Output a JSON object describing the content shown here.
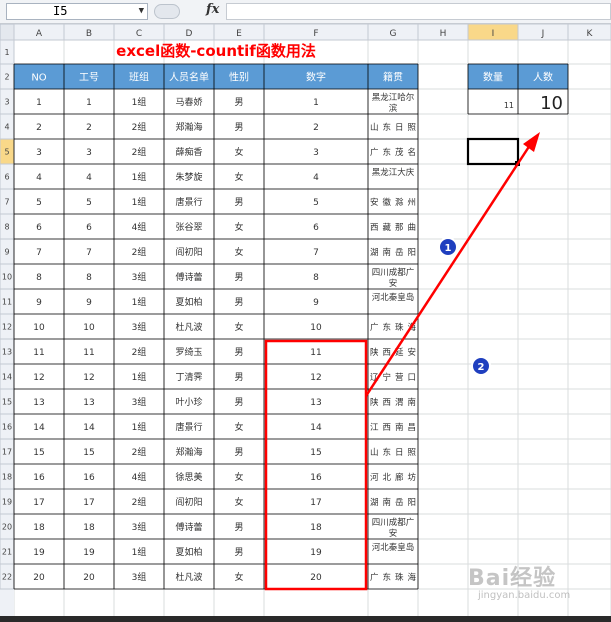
{
  "formula_bar": {
    "name_box": "I5",
    "fx_label": "fx",
    "formula": ""
  },
  "title": "excel函数-countif函数用法",
  "columns": [
    "A",
    "B",
    "C",
    "D",
    "E",
    "F",
    "G",
    "H",
    "I",
    "J",
    "K"
  ],
  "rows": [
    "1",
    "2",
    "3",
    "4",
    "5",
    "6",
    "7",
    "8",
    "9",
    "10",
    "11",
    "12",
    "13",
    "14",
    "15",
    "16",
    "17",
    "18",
    "19",
    "20",
    "21",
    "22"
  ],
  "active_column": "I",
  "active_row": "5",
  "table": {
    "headers": [
      "NO",
      "工号",
      "班组",
      "人员名单",
      "性别",
      "数字",
      "籍贯"
    ],
    "rows": [
      [
        "1",
        "1",
        "1组",
        "马春娇",
        "男",
        "1",
        "黑龙江哈尔滨"
      ],
      [
        "2",
        "2",
        "2组",
        "郑瀚海",
        "男",
        "2",
        "山东日照"
      ],
      [
        "3",
        "3",
        "2组",
        "薛痴香",
        "女",
        "3",
        "广东茂名"
      ],
      [
        "4",
        "4",
        "1组",
        "朱梦旋",
        "女",
        "4",
        "黑龙江大庆"
      ],
      [
        "5",
        "5",
        "1组",
        "唐景行",
        "男",
        "5",
        "安徽滁州"
      ],
      [
        "6",
        "6",
        "4组",
        "张谷翠",
        "女",
        "6",
        "西藏那曲"
      ],
      [
        "7",
        "7",
        "2组",
        "阎初阳",
        "女",
        "7",
        "湖南岳阳"
      ],
      [
        "8",
        "8",
        "3组",
        "傅诗蕾",
        "男",
        "8",
        "四川成都广安"
      ],
      [
        "9",
        "9",
        "1组",
        "夏如柏",
        "男",
        "9",
        "河北秦皇岛"
      ],
      [
        "10",
        "10",
        "3组",
        "杜凡波",
        "女",
        "10",
        "广东珠海"
      ],
      [
        "11",
        "11",
        "2组",
        "罗绮玉",
        "男",
        "11",
        "陕西延安"
      ],
      [
        "12",
        "12",
        "1组",
        "丁清霁",
        "男",
        "12",
        "辽宁营口"
      ],
      [
        "13",
        "13",
        "3组",
        "叶小珍",
        "男",
        "13",
        "陕西渭南"
      ],
      [
        "14",
        "14",
        "1组",
        "唐景行",
        "女",
        "14",
        "江西南昌"
      ],
      [
        "15",
        "15",
        "2组",
        "郑瀚海",
        "男",
        "15",
        "山东日照"
      ],
      [
        "16",
        "16",
        "4组",
        "徐思美",
        "女",
        "16",
        "河北廊坊"
      ],
      [
        "17",
        "17",
        "2组",
        "阎初阳",
        "女",
        "17",
        "湖南岳阳"
      ],
      [
        "18",
        "18",
        "3组",
        "傅诗蕾",
        "男",
        "18",
        "四川成都广安"
      ],
      [
        "19",
        "19",
        "1组",
        "夏如柏",
        "男",
        "19",
        "河北秦皇岛"
      ],
      [
        "20",
        "20",
        "3组",
        "杜凡波",
        "女",
        "20",
        "广东珠海"
      ]
    ]
  },
  "summary": {
    "headers": [
      "数量",
      "人数"
    ],
    "values": [
      "11",
      "10"
    ]
  },
  "annotations": {
    "badge_1": "1",
    "badge_2": "2"
  },
  "watermark": {
    "logo": "Bai经验",
    "url": "jingyan.baidu.com"
  },
  "colors": {
    "header_fill": "#5b9bd5",
    "header_text": "#ffffff",
    "title": "#ff0000",
    "annotation": "#ff0000",
    "badge": "#1f3fbf",
    "grid": "#dadcdd",
    "border": "#000000"
  }
}
